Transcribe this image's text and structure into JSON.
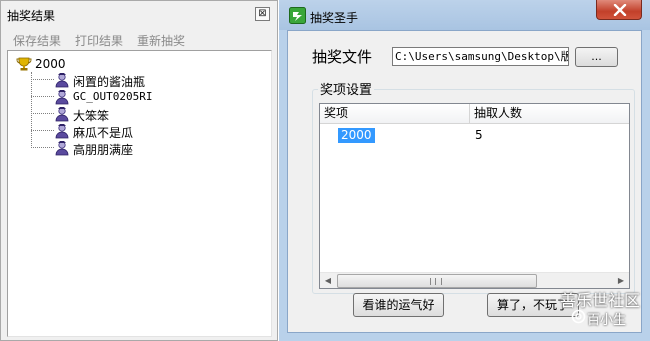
{
  "left_window": {
    "title": "抽奖结果",
    "close_glyph": "⊠",
    "menu": [
      "保存结果",
      "打印结果",
      "重新抽奖"
    ],
    "tree": {
      "root": "2000",
      "root_icon": "trophy-icon",
      "children": [
        "闲置的酱油瓶",
        "GC_OUT0205RI",
        "大笨笨",
        "麻瓜不是瓜",
        "高朋朋满座"
      ],
      "child_icon": "user-icon"
    }
  },
  "right_window": {
    "title": "抽奖圣手",
    "file_label": "抽奖文件",
    "file_path": "C:\\Users\\samsung\\Desktop\\版块",
    "browse_label": "...",
    "group_title": "奖项设置",
    "columns": [
      "奖项",
      "抽取人数"
    ],
    "rows": [
      {
        "prize": "2000",
        "count": "5",
        "selected": true
      }
    ],
    "buttons": {
      "lucky": "看谁的运气好",
      "quit": "算了，不玩了"
    }
  },
  "watermark": {
    "line1": "善乐世社区",
    "line2": "百小生"
  },
  "colors": {
    "selection": "#3399ff",
    "titlebar": "#bcd2ea",
    "close_button": "#c2402a",
    "app_icon": "#3aa63a"
  }
}
